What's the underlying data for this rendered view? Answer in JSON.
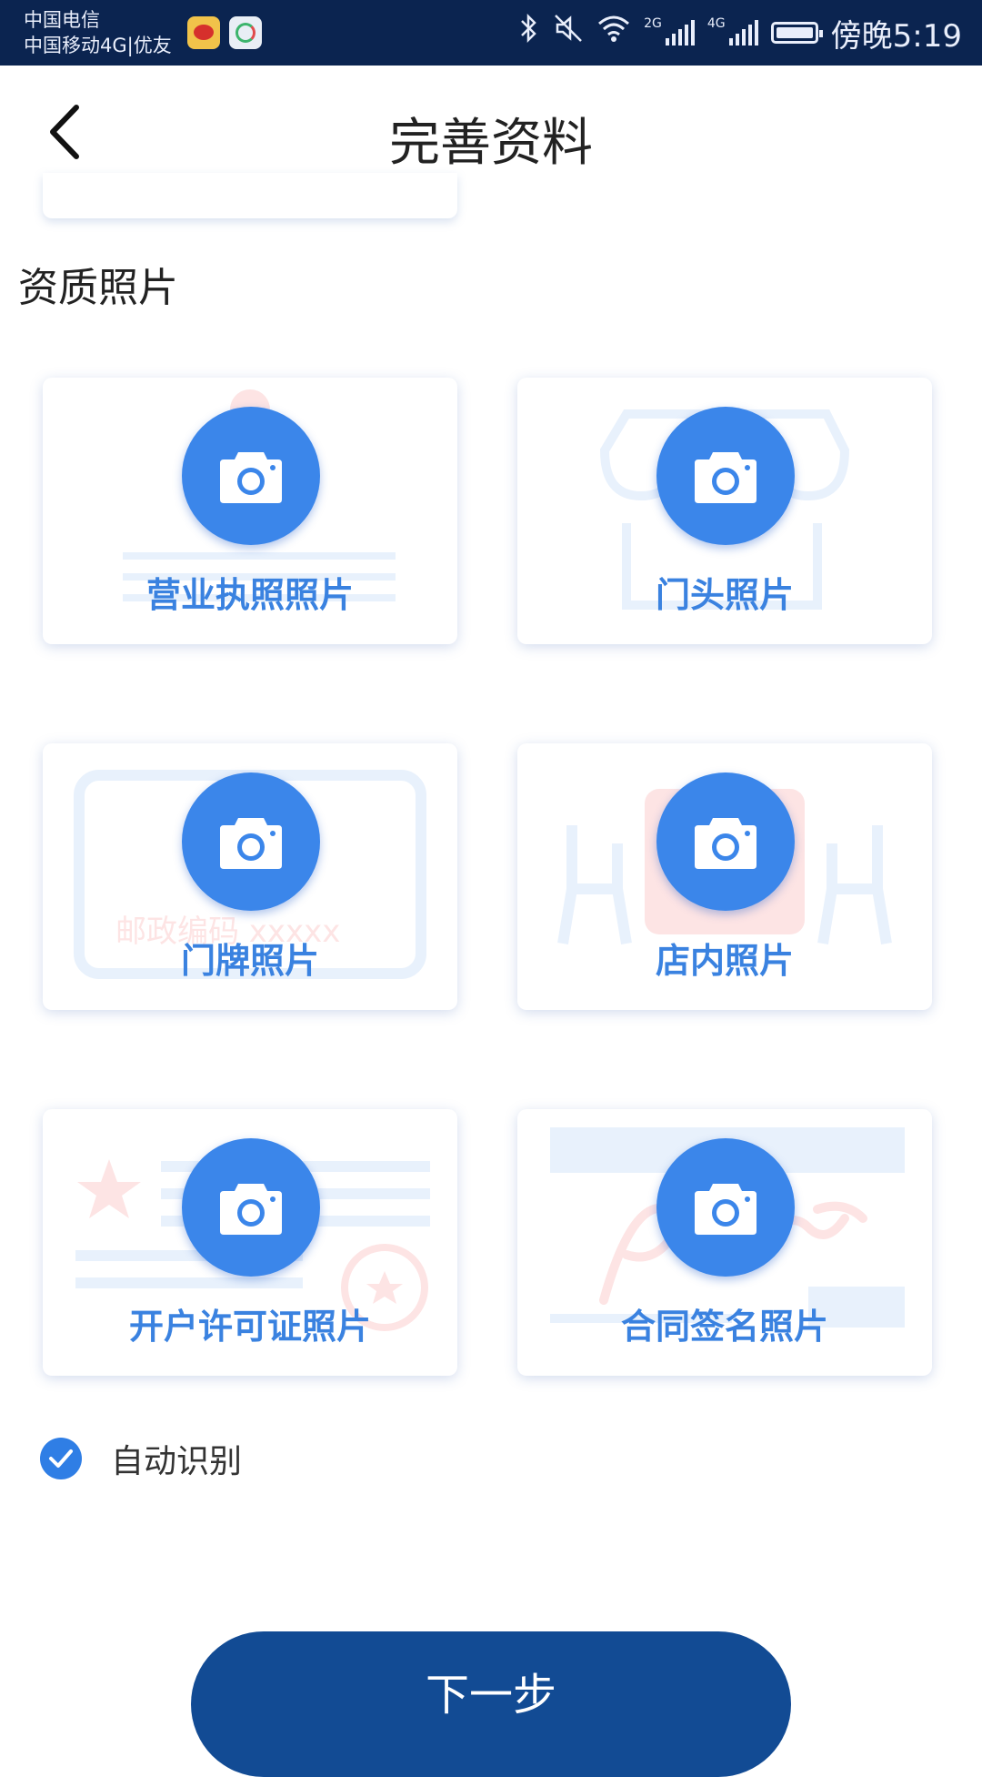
{
  "status_bar": {
    "carrier_1": "中国电信",
    "carrier_2": "中国移动4G|优友",
    "network_1": "2G",
    "network_2": "4G",
    "time": "傍晚5:19",
    "icons": [
      "weibo-icon",
      "app-icon",
      "bluetooth-icon",
      "mute-icon",
      "wifi-icon",
      "signal-icon",
      "battery-icon"
    ]
  },
  "header": {
    "title": "完善资料",
    "back_icon": "chevron-left-icon"
  },
  "section": {
    "title": "资质照片"
  },
  "cards": [
    {
      "label": "营业执照照片",
      "icon": "camera-icon"
    },
    {
      "label": "门头照片",
      "icon": "camera-icon"
    },
    {
      "label": "门牌照片",
      "icon": "camera-icon",
      "watermark": "邮政编码 xxxxx"
    },
    {
      "label": "店内照片",
      "icon": "camera-icon"
    },
    {
      "label": "开户许可证照片",
      "icon": "camera-icon"
    },
    {
      "label": "合同签名照片",
      "icon": "camera-icon"
    }
  ],
  "auto_recognize": {
    "label": "自动识别",
    "checked": true
  },
  "next_button": {
    "label": "下一步"
  },
  "colors": {
    "status_bar": "#0b2450",
    "accent": "#3b86ea",
    "label": "#3a82e0",
    "button": "#124b94",
    "watermark_blue": "#e8f1fc",
    "watermark_red": "#fde4e4"
  }
}
